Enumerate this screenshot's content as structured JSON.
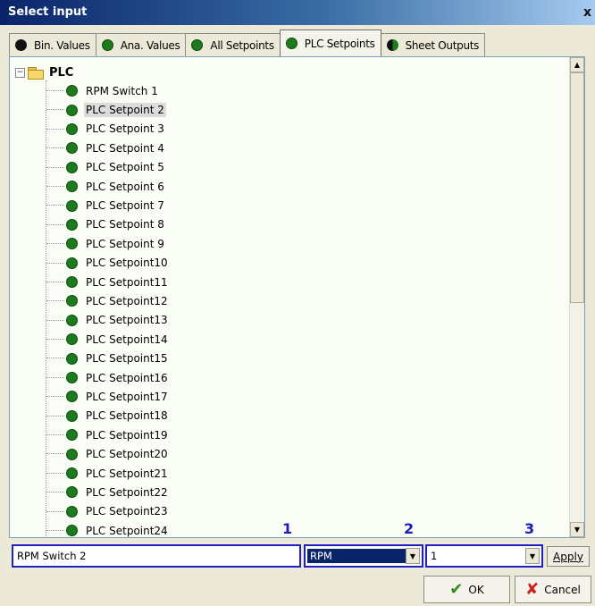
{
  "window": {
    "title": "Select input",
    "close_glyph": "x"
  },
  "tabs": [
    {
      "label": "Bin. Values",
      "icon": "black-dot",
      "active": false
    },
    {
      "label": "Ana. Values",
      "icon": "green-dot",
      "active": false
    },
    {
      "label": "All Setpoints",
      "icon": "green-dot",
      "active": false
    },
    {
      "label": "PLC Setpoints",
      "icon": "green-dot",
      "active": true
    },
    {
      "label": "Sheet Outputs",
      "icon": "half-dot",
      "active": false
    }
  ],
  "tree": {
    "root_label": "PLC",
    "expander_glyph": "−",
    "selected_index": 1,
    "items": [
      "RPM Switch 1",
      "PLC Setpoint 2",
      "PLC Setpoint 3",
      "PLC Setpoint 4",
      "PLC Setpoint 5",
      "PLC Setpoint 6",
      "PLC Setpoint 7",
      "PLC Setpoint 8",
      "PLC Setpoint 9",
      "PLC Setpoint10",
      "PLC Setpoint11",
      "PLC Setpoint12",
      "PLC Setpoint13",
      "PLC Setpoint14",
      "PLC Setpoint15",
      "PLC Setpoint16",
      "PLC Setpoint17",
      "PLC Setpoint18",
      "PLC Setpoint19",
      "PLC Setpoint20",
      "PLC Setpoint21",
      "PLC Setpoint22",
      "PLC Setpoint23",
      "PLC Setpoint24"
    ]
  },
  "scrollbar": {
    "up_glyph": "▲",
    "down_glyph": "▼"
  },
  "markers": [
    "1",
    "2",
    "3"
  ],
  "bottom": {
    "name_value": "RPM Switch 2",
    "unit_value": "RPM",
    "decimals_value": "1",
    "dropdown_glyph": "▼",
    "apply_label": "Apply"
  },
  "buttons": {
    "ok_icon": "✔",
    "ok_label": "OK",
    "cancel_icon": "✘",
    "cancel_label": "Cancel"
  },
  "colors": {
    "accent": "#2020c0",
    "green_dot": "#1d7a1d",
    "title_start": "#0a246a"
  }
}
